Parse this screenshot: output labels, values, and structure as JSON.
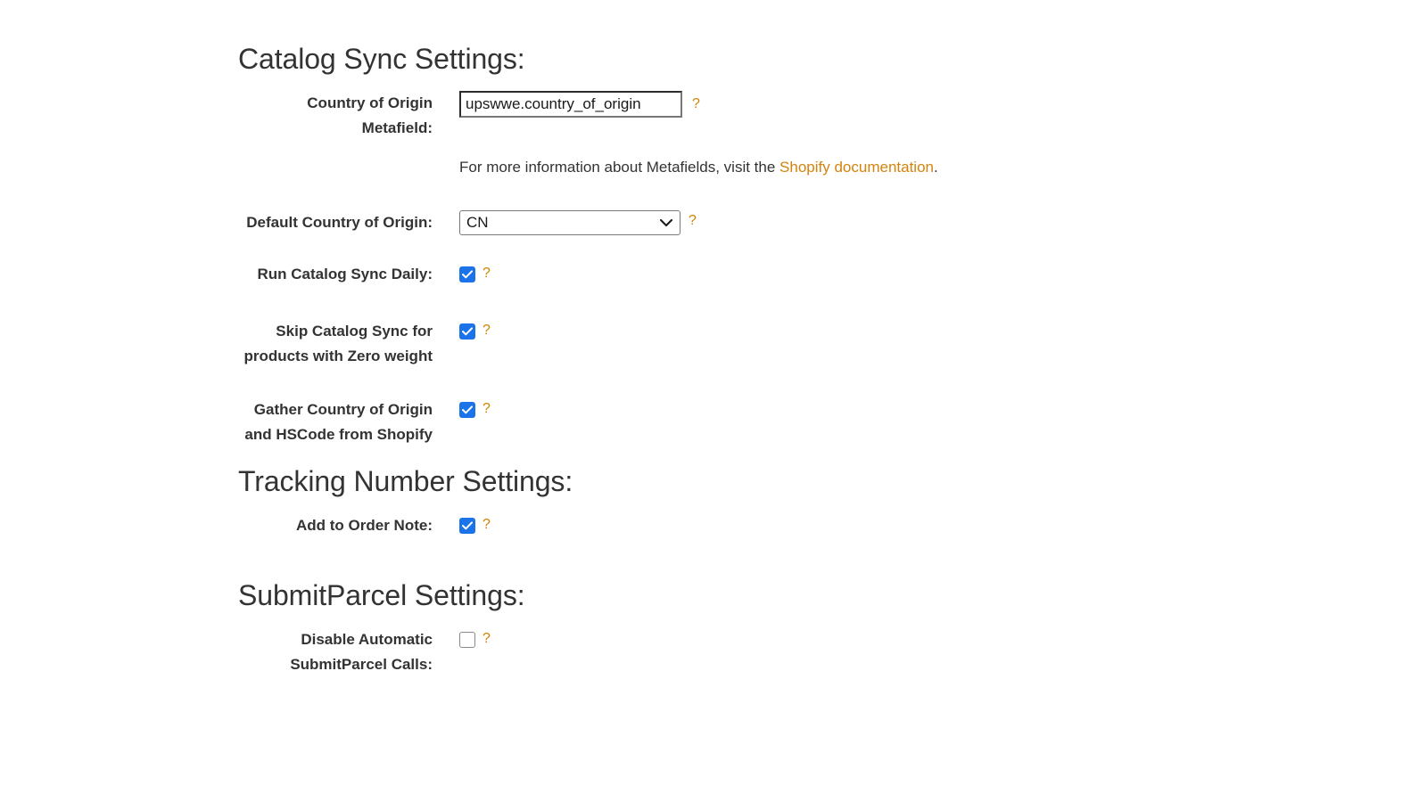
{
  "sections": [
    {
      "id": "catalog-sync",
      "heading": "Catalog Sync Settings:",
      "fields": [
        {
          "id": "country-of-origin-metafield",
          "label": "Country of Origin Metafield:",
          "type": "text",
          "value": "upswwe.country_of_origin",
          "help": "?"
        },
        {
          "id": "default-country-of-origin",
          "label": "Default Country of Origin:",
          "type": "select",
          "value": "CN",
          "help": "?"
        },
        {
          "id": "run-catalog-sync-daily",
          "label": "Run Catalog Sync Daily:",
          "type": "checkbox",
          "checked": true,
          "help": "?"
        },
        {
          "id": "skip-catalog-sync-zero-weight",
          "label": "Skip Catalog Sync for products with Zero weight",
          "type": "checkbox",
          "checked": true,
          "help": "?"
        },
        {
          "id": "gather-country-hscode-shopify",
          "label": "Gather Country of Origin and HSCode from Shopify",
          "type": "checkbox",
          "checked": true,
          "help": "?"
        }
      ],
      "helper": {
        "prefix": "For more information about Metafields, visit the ",
        "link_text": "Shopify documentation",
        "suffix": "."
      }
    },
    {
      "id": "tracking-number",
      "heading": "Tracking Number Settings:",
      "fields": [
        {
          "id": "add-to-order-note",
          "label": "Add to Order Note:",
          "type": "checkbox",
          "checked": true,
          "help": "?"
        }
      ]
    },
    {
      "id": "submit-parcel",
      "heading": "SubmitParcel Settings:",
      "fields": [
        {
          "id": "disable-automatic-submitparcel-calls",
          "label": "Disable Automatic SubmitParcel Calls:",
          "type": "checkbox",
          "checked": false,
          "help": "?"
        }
      ]
    }
  ],
  "colors": {
    "accent_link": "#d4830e",
    "help_marker": "#cc8400",
    "checkbox_checked": "#1a73e8",
    "text": "#333333",
    "background": "#ffffff"
  },
  "icons": {
    "chevron_down": "chevron-down-icon",
    "checkmark": "checkmark-icon",
    "help": "question-mark-icon"
  }
}
